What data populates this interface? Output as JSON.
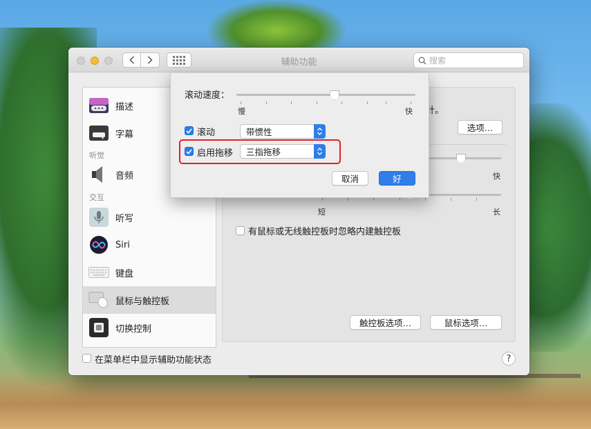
{
  "window": {
    "title": "辅助功能",
    "search_placeholder": "搜索"
  },
  "sidebar": {
    "items": [
      {
        "label": "描述"
      },
      {
        "label": "字幕"
      },
      {
        "label": "音频"
      },
      {
        "label": "听写"
      },
      {
        "label": "Siri"
      },
      {
        "label": "键盘"
      },
      {
        "label": "鼠标与触控板"
      },
      {
        "label": "切换控制"
      }
    ],
    "sections": {
      "hearing": "听觉",
      "interaction": "交互"
    },
    "selected_index": 6
  },
  "main": {
    "hint_fragment": "针。",
    "options_button": "选项…",
    "fast_label": "快",
    "short_label": "短",
    "long_label": "长",
    "ignore_builtin_label": "有鼠标或无线触控板时忽略内建触控板",
    "trackpad_options_button": "触控板选项…",
    "mouse_options_button": "鼠标选项…"
  },
  "footer": {
    "show_status_label": "在菜单栏中显示辅助功能状态",
    "help_label": "?"
  },
  "sheet": {
    "scroll_speed_label": "滚动速度：",
    "slow_label": "慢",
    "fast_label": "快",
    "scroll_speed_value": 0.55,
    "scroll_label": "滚动",
    "scroll_checked": true,
    "scroll_popup_value": "带惯性",
    "drag_label": "启用拖移",
    "drag_checked": true,
    "drag_popup_value": "三指拖移",
    "cancel_button": "取消",
    "ok_button": "好"
  },
  "colors": {
    "accent": "#2f7ee9",
    "highlight": "#e0202a"
  }
}
